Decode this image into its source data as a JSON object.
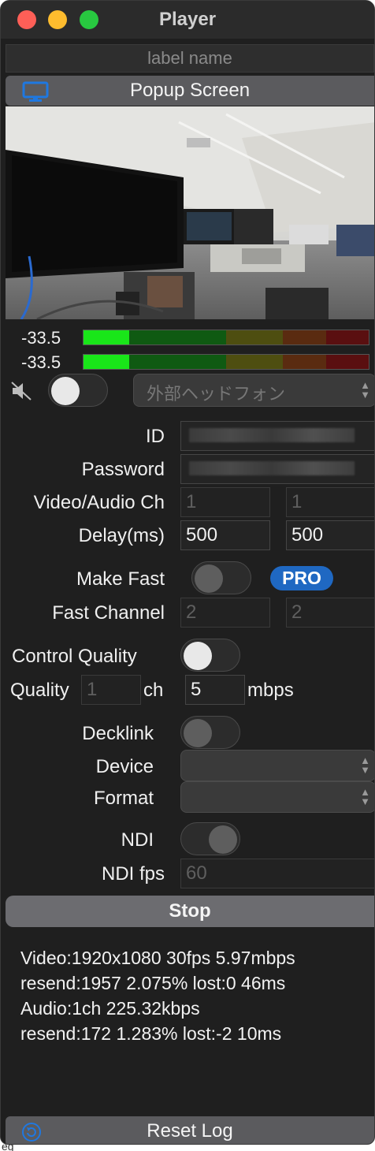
{
  "window": {
    "title": "Player"
  },
  "label_field": {
    "placeholder": "label name"
  },
  "popup": {
    "label": "Popup Screen",
    "icon": "monitor-icon"
  },
  "audio": {
    "meters": [
      {
        "value": "-33.5",
        "level": 0.16
      },
      {
        "value": "-33.5",
        "level": 0.16
      }
    ],
    "mute_icon": "speaker-muted-icon",
    "monitor_toggle": false,
    "output_device": "外部ヘッドフォン"
  },
  "form": {
    "id": {
      "label": "ID",
      "value": ""
    },
    "password": {
      "label": "Password",
      "value": ""
    },
    "video_audio_ch": {
      "label": "Video/Audio Ch",
      "video": "1",
      "audio": "1"
    },
    "delay": {
      "label": "Delay(ms)",
      "video": "500",
      "audio": "500"
    },
    "make_fast": {
      "label": "Make Fast",
      "enabled": false,
      "badge": "PRO"
    },
    "fast_channel": {
      "label": "Fast Channel",
      "video": "2",
      "audio": "2"
    },
    "control_quality": {
      "label": "Control Quality",
      "enabled": true
    },
    "quality": {
      "label": "Quality",
      "ch_placeholder": "1",
      "ch_unit": "ch",
      "mbps": "5",
      "mbps_unit": "mbps"
    },
    "decklink": {
      "label": "Decklink",
      "enabled": false
    },
    "device": {
      "label": "Device",
      "value": ""
    },
    "format": {
      "label": "Format",
      "value": ""
    },
    "ndi": {
      "label": "NDI",
      "enabled": true
    },
    "ndi_fps": {
      "label": "NDI fps",
      "value": "60"
    }
  },
  "stop_button": {
    "label": "Stop"
  },
  "log": {
    "lines": [
      "Video:1920x1080 30fps 5.97mbps",
      "resend:1957 2.075% lost:0 46ms",
      "Audio:1ch 225.32kbps",
      "resend:172 1.283% lost:-2 10ms"
    ]
  },
  "reset_button": {
    "label": "Reset Log",
    "icon": "reset-icon"
  },
  "colors": {
    "accent": "#1f68c2",
    "meter_green": "#19e619",
    "badge_blue": "#1f68c2"
  }
}
